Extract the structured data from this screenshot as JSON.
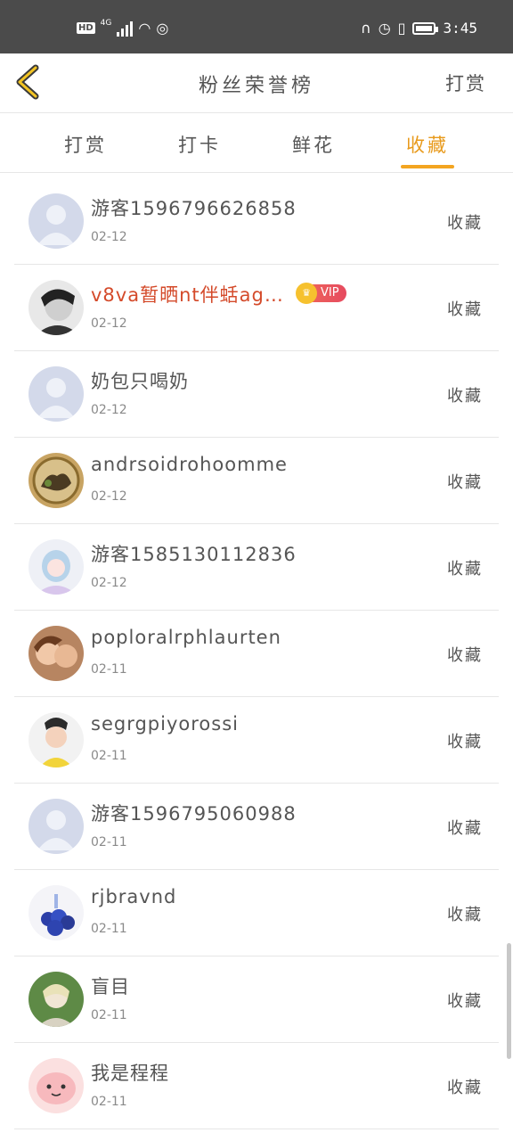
{
  "status_bar": {
    "hd": "HD",
    "network": "4G",
    "time": "3:45",
    "icons": [
      "headphones-icon",
      "alarm-icon",
      "vibrate-icon",
      "battery-icon"
    ]
  },
  "header": {
    "title": "粉丝荣誉榜",
    "right_label": "打赏"
  },
  "tabs": [
    {
      "label": "打赏",
      "active": false
    },
    {
      "label": "打卡",
      "active": false
    },
    {
      "label": "鲜花",
      "active": false
    },
    {
      "label": "收藏",
      "active": true
    }
  ],
  "colors": {
    "accent": "#f3a521",
    "vip_name": "#d44a2a",
    "status_bar": "#4b4b4b"
  },
  "rows": [
    {
      "name": "游客1596796626858",
      "date": "02-12",
      "action": "收藏",
      "avatar": "default-avatar"
    },
    {
      "name": "v8va暂晒nt伴蛞ag…",
      "date": "02-12",
      "action": "收藏",
      "avatar": "photo-avatar",
      "vip": "VIP"
    },
    {
      "name": "奶包只喝奶",
      "date": "02-12",
      "action": "收藏",
      "avatar": "default-avatar"
    },
    {
      "name": "andrsoidrohoomme",
      "date": "02-12",
      "action": "收藏",
      "avatar": "photo-avatar"
    },
    {
      "name": "游客1585130112836",
      "date": "02-12",
      "action": "收藏",
      "avatar": "photo-avatar"
    },
    {
      "name": "poploralrphlaurten",
      "date": "02-11",
      "action": "收藏",
      "avatar": "photo-avatar"
    },
    {
      "name": "segrgpiyorossi",
      "date": "02-11",
      "action": "收藏",
      "avatar": "photo-avatar"
    },
    {
      "name": "游客1596795060988",
      "date": "02-11",
      "action": "收藏",
      "avatar": "default-avatar"
    },
    {
      "name": "rjbravnd",
      "date": "02-11",
      "action": "收藏",
      "avatar": "photo-avatar"
    },
    {
      "name": "盲目",
      "date": "02-11",
      "action": "收藏",
      "avatar": "photo-avatar"
    },
    {
      "name": "我是程程",
      "date": "02-11",
      "action": "收藏",
      "avatar": "photo-avatar"
    }
  ]
}
